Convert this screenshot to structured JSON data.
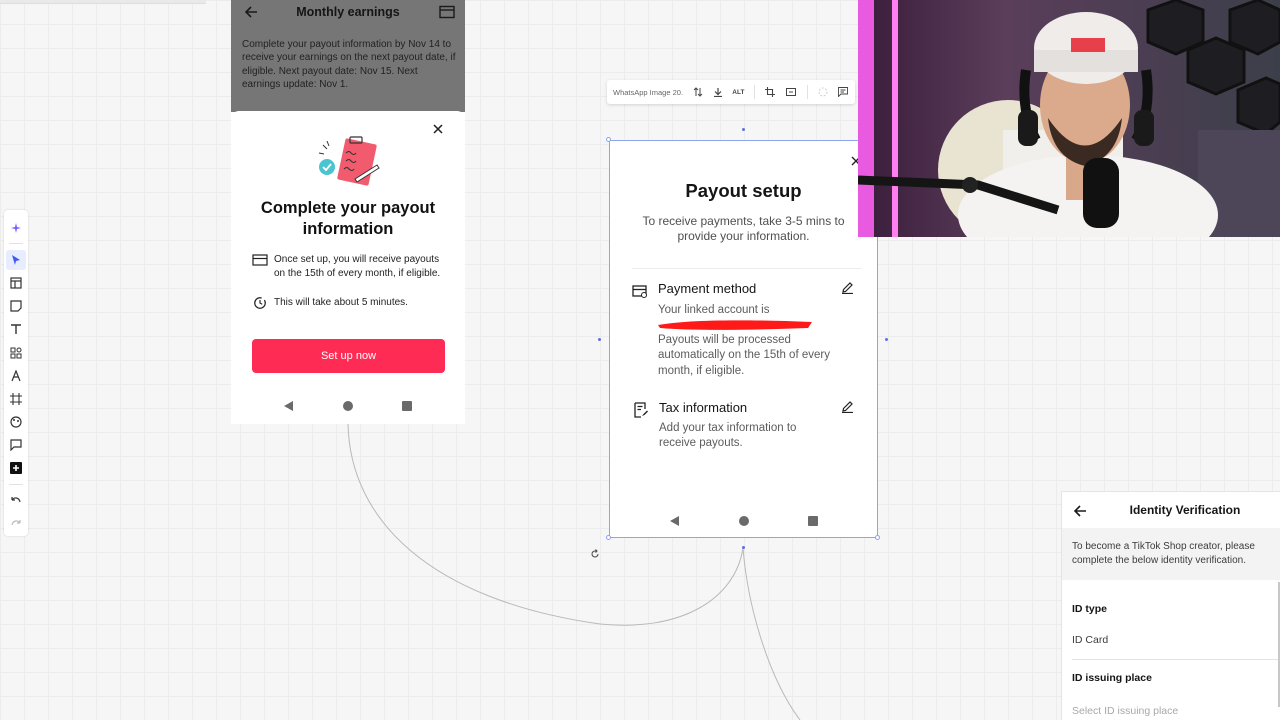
{
  "left_phone": {
    "header": {
      "title": "Monthly earnings"
    },
    "notice": "Complete your payout information by Nov 14 to receive your earnings on the next payout date, if eligible. Next payout date: Nov 15. Next earnings update: Nov 1.",
    "sheet": {
      "title": "Complete your payout information",
      "rows": [
        {
          "icon": "card-icon",
          "text": "Once set up, you will receive payouts on the 15th of every month, if eligible."
        },
        {
          "icon": "clock-icon",
          "text": "This will take about 5 minutes."
        }
      ],
      "button_label": "Set up now",
      "button_color": "#fe2c55"
    }
  },
  "image_toolbar": {
    "file_name": "WhatsApp Image 20...",
    "alt_label": "ALT"
  },
  "payout_setup": {
    "title": "Payout setup",
    "subtitle": "To receive payments, take 3-5 mins to provide your information.",
    "sections": [
      {
        "title": "Payment method",
        "line1": "Your linked account is",
        "line2": "Payouts will be processed automatically on the 15th of every month, if eligible."
      },
      {
        "title": "Tax information",
        "line1": "Add your tax information to receive payouts."
      }
    ],
    "redaction_color": "#ff1a1a"
  },
  "identity_verification": {
    "title": "Identity Verification",
    "info": "To become a TikTok Shop creator, please complete the below identity verification.",
    "fields": [
      {
        "label": "ID type",
        "value": "ID Card"
      },
      {
        "label": "ID issuing place",
        "placeholder": "Select ID issuing place"
      }
    ]
  },
  "colors": {
    "accent": "#fe2c55",
    "selection": "#8da4ef",
    "canvas": "#f6f6f6"
  }
}
